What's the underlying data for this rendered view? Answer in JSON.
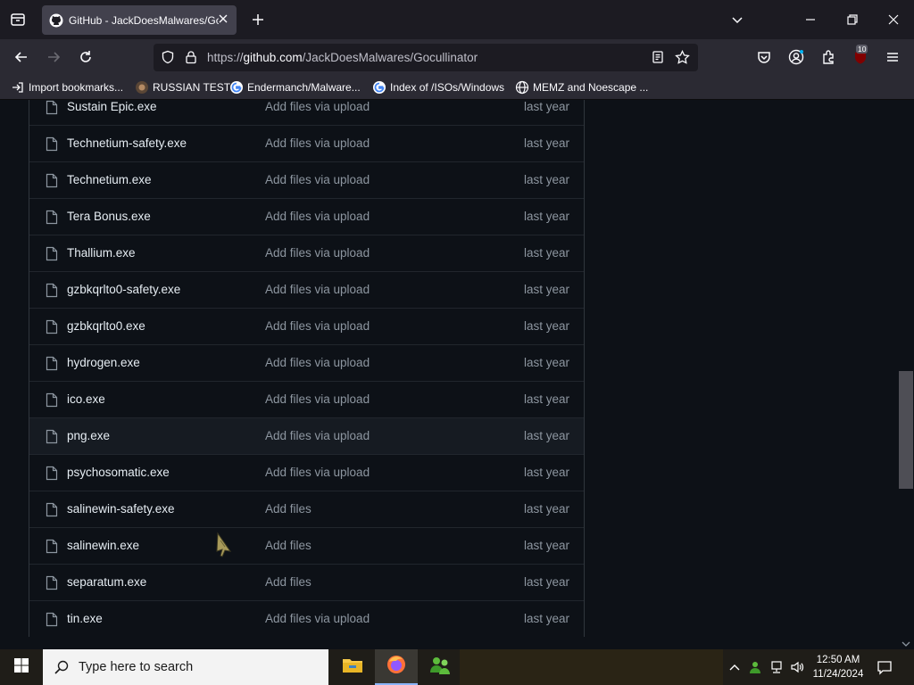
{
  "browser": {
    "tab": {
      "title": "GitHub - JackDoesMalwares/Gocullinator"
    },
    "url": {
      "prefix": "https://",
      "host": "github.com",
      "path": "/JackDoesMalwares/Gocullinator"
    },
    "extension_badge": "10",
    "bookmarks": [
      {
        "label": "Import bookmarks...",
        "icon": "import-icon"
      },
      {
        "label": "RUSSIAN TEST",
        "icon": "site-favicon"
      },
      {
        "label": "Endermanch/Malware...",
        "icon": "google-icon"
      },
      {
        "label": "Index of /ISOs/Windows",
        "icon": "google-icon"
      },
      {
        "label": "MEMZ and Noescape ...",
        "icon": "globe-icon"
      }
    ]
  },
  "files": [
    {
      "name": "Sustain Epic.exe",
      "message": "Add files via upload",
      "date": "last year"
    },
    {
      "name": "Technetium-safety.exe",
      "message": "Add files via upload",
      "date": "last year"
    },
    {
      "name": "Technetium.exe",
      "message": "Add files via upload",
      "date": "last year"
    },
    {
      "name": "Tera Bonus.exe",
      "message": "Add files via upload",
      "date": "last year"
    },
    {
      "name": "Thallium.exe",
      "message": "Add files via upload",
      "date": "last year"
    },
    {
      "name": "gzbkqrlto0-safety.exe",
      "message": "Add files via upload",
      "date": "last year"
    },
    {
      "name": "gzbkqrlto0.exe",
      "message": "Add files via upload",
      "date": "last year"
    },
    {
      "name": "hydrogen.exe",
      "message": "Add files via upload",
      "date": "last year"
    },
    {
      "name": "ico.exe",
      "message": "Add files via upload",
      "date": "last year"
    },
    {
      "name": "png.exe",
      "message": "Add files via upload",
      "date": "last year"
    },
    {
      "name": "psychosomatic.exe",
      "message": "Add files via upload",
      "date": "last year"
    },
    {
      "name": "salinewin-safety.exe",
      "message": "Add files",
      "date": "last year"
    },
    {
      "name": "salinewin.exe",
      "message": "Add files",
      "date": "last year"
    },
    {
      "name": "separatum.exe",
      "message": "Add files",
      "date": "last year"
    },
    {
      "name": "tin.exe",
      "message": "Add files via upload",
      "date": "last year"
    }
  ],
  "taskbar": {
    "search_placeholder": "Type here to search",
    "time": "12:50 AM",
    "date": "11/24/2024"
  },
  "colors": {
    "accent": "#8ab4f8",
    "background": "#0d1117",
    "text": "#e6edf3",
    "muted": "#8d96a0"
  }
}
